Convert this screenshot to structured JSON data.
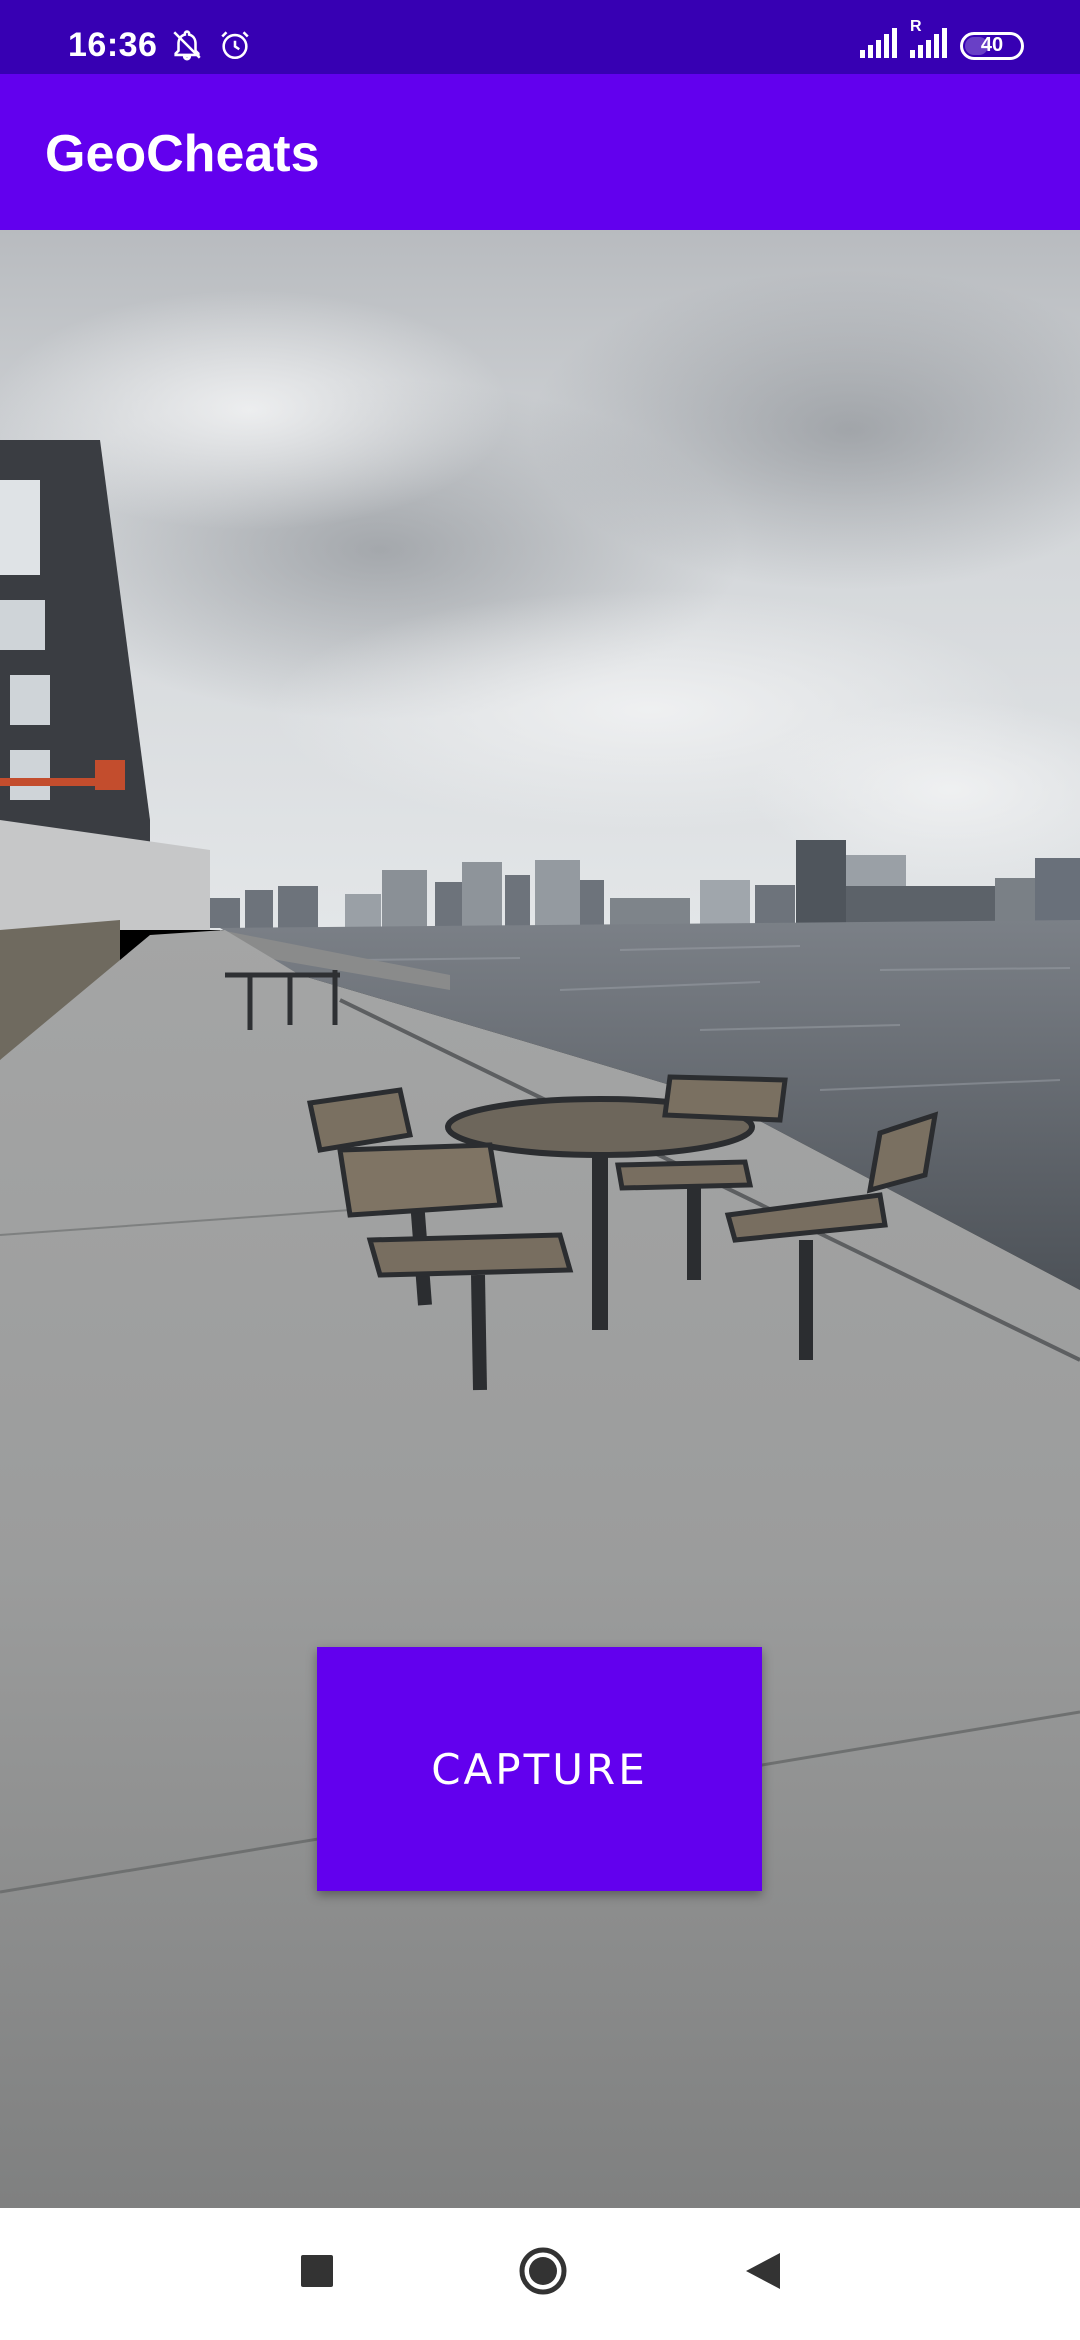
{
  "status_bar": {
    "time": "16:36",
    "battery": "40",
    "left_icons": [
      "bell-off-icon",
      "alarm-icon"
    ],
    "right_icons": [
      "signal-icon",
      "signal-roaming-icon",
      "battery-icon"
    ],
    "roaming_label": "R"
  },
  "app_bar": {
    "title": "GeoCheats"
  },
  "camera": {
    "content": "camera-preview"
  },
  "capture_button": {
    "label": "CAPTURE"
  },
  "nav_bar": {
    "buttons": [
      "recents",
      "home",
      "back"
    ]
  },
  "colors": {
    "primary": "#6200EE",
    "primary_dark": "#3700B3",
    "on_primary": "#FFFFFF",
    "nav_background": "#FFFFFF"
  }
}
